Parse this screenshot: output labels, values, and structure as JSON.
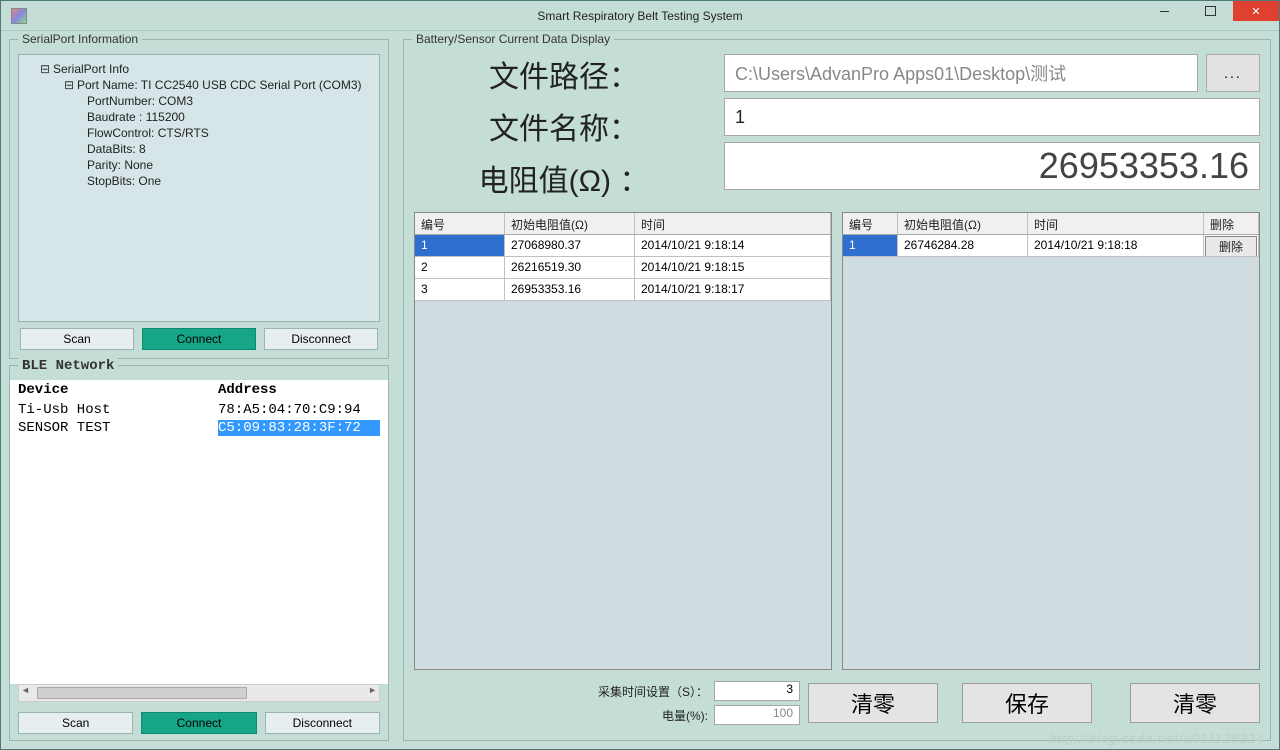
{
  "window": {
    "title": "Smart Respiratory Belt Testing System"
  },
  "serial_group": {
    "title": "SerialPort Information",
    "tree": {
      "root": "SerialPort Info",
      "port_name": "Port Name: TI CC2540 USB CDC Serial Port (COM3)",
      "port_number": "PortNumber: COM3",
      "baudrate": "Baudrate :  115200",
      "flowcontrol": "FlowControl: CTS/RTS",
      "databits": "DataBits: 8",
      "parity": "Parity: None",
      "stopbits": "StopBits: One"
    },
    "buttons": {
      "scan": "Scan",
      "connect": "Connect",
      "disconnect": "Disconnect"
    }
  },
  "ble_group": {
    "title": "BLE Network",
    "headers": {
      "device": "Device",
      "address": "Address"
    },
    "rows": [
      {
        "device": "Ti-Usb Host",
        "address": "78:A5:04:70:C9:94",
        "selected": false
      },
      {
        "device": "SENSOR TEST",
        "address": "C5:09:83:28:3F:72",
        "selected": true
      }
    ],
    "buttons": {
      "scan": "Scan",
      "connect": "Connect",
      "disconnect": "Disconnect"
    }
  },
  "data_group": {
    "title": "Battery/Sensor Current Data Display",
    "labels": {
      "file_path": "文件路径：",
      "file_name": "文件名称：",
      "resistance": "电阻值(Ω) ："
    },
    "file_path_value": "C:\\Users\\AdvanPro Apps01\\Desktop\\测试",
    "file_name_value": "1",
    "browse": "...",
    "resistance_value": "26953353.16",
    "left_grid": {
      "headers": {
        "num": "编号",
        "val": "初始电阻值(Ω)",
        "time": "时间"
      },
      "rows": [
        {
          "num": "1",
          "val": "27068980.37",
          "time": "2014/10/21 9:18:14",
          "selected": true
        },
        {
          "num": "2",
          "val": "26216519.30",
          "time": "2014/10/21 9:18:15",
          "selected": false
        },
        {
          "num": "3",
          "val": "26953353.16",
          "time": "2014/10/21 9:18:17",
          "selected": false
        }
      ]
    },
    "right_grid": {
      "headers": {
        "num": "编号",
        "val": "初始电阻值(Ω)",
        "time": "时间",
        "del": "删除"
      },
      "rows": [
        {
          "num": "1",
          "val": "26746284.28",
          "time": "2014/10/21 9:18:18",
          "selected": true,
          "del": "删除"
        }
      ]
    },
    "bottom": {
      "interval_label": "采集时间设置（S）：",
      "interval_value": "3",
      "battery_label": "电量(%):",
      "battery_value": "100",
      "btn_clear": "清零",
      "btn_save": "保存"
    }
  },
  "watermark": "http://blog.csdn.net/u011125324"
}
